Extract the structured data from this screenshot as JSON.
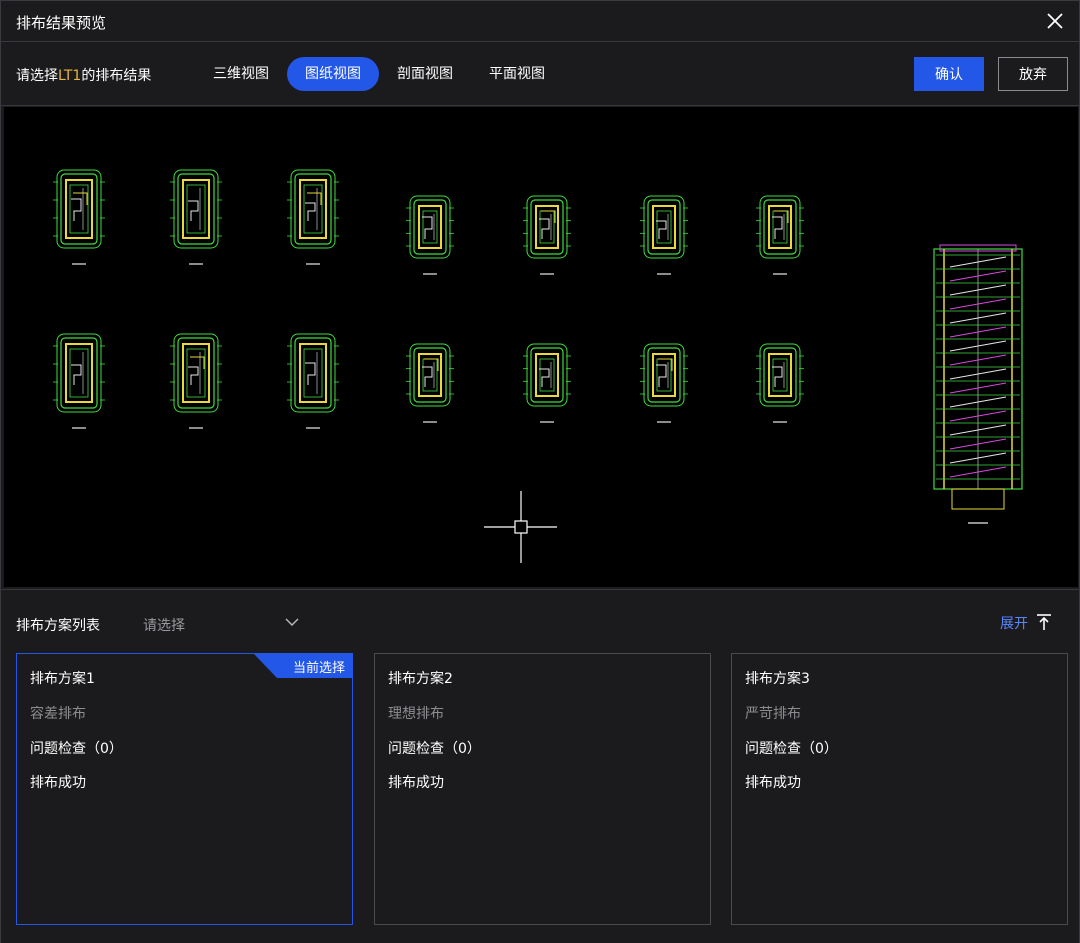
{
  "window": {
    "title": "排布结果预览"
  },
  "toolbar": {
    "prompt_prefix": "请选择",
    "prompt_highlight": "LT1",
    "prompt_suffix": "的排布结果",
    "tabs": [
      {
        "label": "三维视图",
        "active": false
      },
      {
        "label": "图纸视图",
        "active": true
      },
      {
        "label": "剖面视图",
        "active": false
      },
      {
        "label": "平面视图",
        "active": false
      }
    ],
    "confirm_label": "确认",
    "discard_label": "放弃"
  },
  "plan_list": {
    "label": "排布方案列表",
    "select_placeholder": "请选择",
    "expand_label": "展开",
    "cards": [
      {
        "name": "排布方案1",
        "mode": "容差排布",
        "check": "问题检查（0）",
        "status": "排布成功",
        "badge": "当前选择"
      },
      {
        "name": "排布方案2",
        "mode": "理想排布",
        "check": "问题检查（0）",
        "status": "排布成功"
      },
      {
        "name": "排布方案3",
        "mode": "严苛排布",
        "check": "问题检查（0）",
        "status": "排布成功"
      }
    ]
  },
  "colors": {
    "accent": "#2357e8",
    "highlight": "#e7b43c",
    "cad_green": "#3fdc3f",
    "cad_yellow": "#e8d83a",
    "cad_white": "#e8e8e8",
    "cad_magenta": "#d84adf"
  },
  "icons": [
    "close-icon",
    "chevron-down-icon",
    "expand-top-icon"
  ]
}
